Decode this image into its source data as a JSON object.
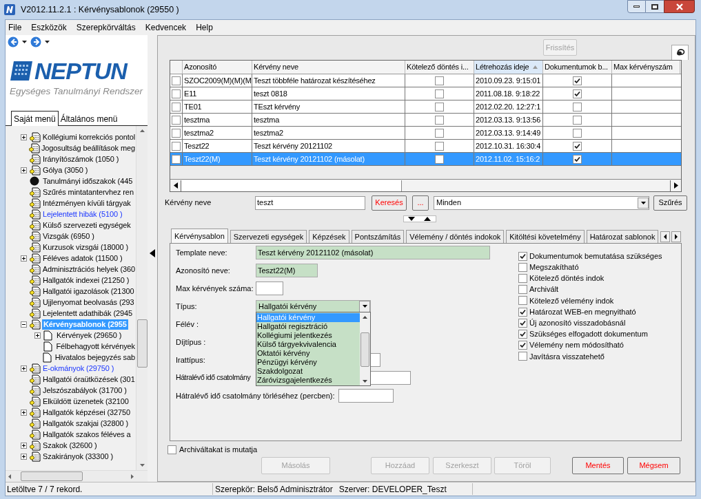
{
  "window": {
    "title": "V2012.11.2.1 : Kérvénysablonok (29550 )"
  },
  "menu": [
    "File",
    "Eszközök",
    "Szerepkörváltás",
    "Kedvencek",
    "Help"
  ],
  "logo": {
    "name": "NEPTUN",
    "tagline": "Egységes Tanulmányi Rendszer"
  },
  "sidebar": {
    "tabs": [
      {
        "label": "Saját menü",
        "selected": true
      },
      {
        "label": "Általános menü",
        "selected": false
      }
    ],
    "tree": [
      {
        "label": "Kollégiumi korrekciós pontol",
        "expanded": false,
        "kind": "form",
        "link": false,
        "selected": false
      },
      {
        "label": "Jogosultság beállítások meg",
        "kind": "form",
        "link": false,
        "selected": false
      },
      {
        "label": "Irányítószámok (1050  )",
        "kind": "form",
        "link": false,
        "selected": false
      },
      {
        "label": "Gólya (3050  )",
        "expanded": false,
        "kind": "form",
        "link": false,
        "selected": false
      },
      {
        "label": "Tanulmányi időszakok (445",
        "kind": "ball",
        "link": false,
        "selected": false
      },
      {
        "label": "Szűrés mintatantervhez ren",
        "kind": "form",
        "link": false,
        "selected": false
      },
      {
        "label": "Intézményen kívüli tárgyak",
        "kind": "form",
        "link": false,
        "selected": false
      },
      {
        "label": "Lejelentett hibák (5100  )",
        "kind": "form",
        "link": true,
        "selected": false
      },
      {
        "label": "Külső szervezeti egységek",
        "kind": "form",
        "link": false,
        "selected": false
      },
      {
        "label": "Vizsgák (6950  )",
        "kind": "form",
        "link": false,
        "selected": false
      },
      {
        "label": "Kurzusok vizsgái (18000  )",
        "kind": "form",
        "link": false,
        "selected": false
      },
      {
        "label": "Féléves adatok (11500  )",
        "expanded": false,
        "kind": "form",
        "link": false,
        "selected": false
      },
      {
        "label": "Adminisztrációs helyek (360",
        "kind": "form",
        "link": false,
        "selected": false
      },
      {
        "label": "Hallgatók indexei (21250  )",
        "kind": "form",
        "link": false,
        "selected": false
      },
      {
        "label": "Hallgatói igazolások (21300",
        "kind": "form",
        "link": false,
        "selected": false
      },
      {
        "label": "Ujjlenyomat beolvasás (293",
        "kind": "form",
        "link": false,
        "selected": false
      },
      {
        "label": "Lejelentett adathibák (2945",
        "kind": "form",
        "link": false,
        "selected": false
      },
      {
        "label": "Kérvénysablonok (2955",
        "expanded": true,
        "kind": "form",
        "link": false,
        "selected": true,
        "children": [
          {
            "label": "Kérvények (29650  )",
            "expanded": false,
            "kind": "page",
            "link": false,
            "selected": false
          },
          {
            "label": "Félbehagyott kérvények",
            "kind": "page",
            "link": false,
            "selected": false
          },
          {
            "label": "Hivatalos bejegyzés sab",
            "kind": "page",
            "link": false,
            "selected": false
          }
        ]
      },
      {
        "label": "E-okmányok (29750  )",
        "expanded": false,
        "kind": "form",
        "link": true,
        "selected": false
      },
      {
        "label": "Hallgatói óraütközések (301",
        "kind": "form",
        "link": false,
        "selected": false
      },
      {
        "label": "Jelszószabályok (31700  )",
        "kind": "form",
        "link": false,
        "selected": false
      },
      {
        "label": "Elküldött üzenetek (32100",
        "kind": "form",
        "link": false,
        "selected": false
      },
      {
        "label": "Hallgatók képzései (32750",
        "expanded": false,
        "kind": "form",
        "link": false,
        "selected": false
      },
      {
        "label": "Hallgatók szakjai (32800  )",
        "kind": "form",
        "link": false,
        "selected": false
      },
      {
        "label": "Hallgatók szakos féléves a",
        "kind": "form",
        "link": false,
        "selected": false
      },
      {
        "label": "Szakok (32600  )",
        "expanded": false,
        "kind": "form",
        "link": false,
        "selected": false
      },
      {
        "label": "Szakirányok (33300  )",
        "expanded": false,
        "kind": "form",
        "link": false,
        "selected": false
      }
    ]
  },
  "refresh_button": {
    "label": "Frissítés",
    "disabled": true
  },
  "table": {
    "columns": [
      {
        "label": "Azonosító",
        "sorted": false
      },
      {
        "label": "Kérvény neve",
        "sorted": false
      },
      {
        "label": "Kötelező döntés i...",
        "sorted": false
      },
      {
        "label": "Létrehozás ideje",
        "sorted": true
      },
      {
        "label": "Dokumentumok b...",
        "sorted": false
      },
      {
        "label": "Max kérvényszám",
        "sorted": false
      }
    ],
    "rows": [
      {
        "checked": false,
        "id": "SZOC2009(M)(M)(M",
        "name": "Teszt többféle határozat készítéséhez",
        "mandatory_decision": false,
        "created": "2010.09.23. 9:15:01",
        "documents": true,
        "selected": false
      },
      {
        "checked": false,
        "id": "E11",
        "name": "teszt 0818",
        "mandatory_decision": false,
        "created": "2011.08.18. 9:18:22",
        "documents": true,
        "selected": false
      },
      {
        "checked": false,
        "id": "TE01",
        "name": "TEszt kérvény",
        "mandatory_decision": false,
        "created": "2012.02.20. 12:27:1",
        "documents": false,
        "selected": false
      },
      {
        "checked": false,
        "id": "tesztma",
        "name": "tesztma",
        "mandatory_decision": false,
        "created": "2012.03.13. 9:13:56",
        "documents": false,
        "selected": false
      },
      {
        "checked": false,
        "id": "tesztma2",
        "name": "tesztma2",
        "mandatory_decision": false,
        "created": "2012.03.13. 9:14:49",
        "documents": false,
        "selected": false
      },
      {
        "checked": false,
        "id": "Teszt22",
        "name": "Teszt kérvény 20121102",
        "mandatory_decision": false,
        "created": "2012.10.31. 16:30:4",
        "documents": true,
        "selected": false
      },
      {
        "checked": false,
        "id": "Teszt22(M)",
        "name": "Teszt kérvény 20121102 (másolat)",
        "mandatory_decision": false,
        "created": "2012.11.02. 15:16:2",
        "documents": true,
        "selected": true
      }
    ]
  },
  "search": {
    "label": "Kérvény neve",
    "value": "teszt",
    "search_button": "Keresés",
    "more_button": "...",
    "filter": "Minden",
    "filter_button": "Szűrés"
  },
  "detail_tabs": [
    {
      "label": "Kérvénysablon",
      "selected": true
    },
    {
      "label": "Szervezeti egységek",
      "selected": false
    },
    {
      "label": "Képzések",
      "selected": false
    },
    {
      "label": "Pontszámítás",
      "selected": false
    },
    {
      "label": "Vélemény / döntés indokok",
      "selected": false
    },
    {
      "label": "Kitöltési követelmény",
      "selected": false
    },
    {
      "label": "Határozat sablonok",
      "selected": false
    }
  ],
  "form": [
    {
      "kind": "text",
      "label": "Template neve:",
      "value": "Teszt kérvény 20121102 (másolat)",
      "required": true
    },
    {
      "kind": "text",
      "label": "Azonosító neve:",
      "value": "Teszt22(M)",
      "required": true
    },
    {
      "kind": "text",
      "label": "Max kérvények száma:",
      "required": false
    },
    {
      "kind": "select",
      "label": "Típus:",
      "value": "Hallgatói kérvény",
      "required": true,
      "open": true,
      "options": [
        {
          "label": "Hallgatói kérvény",
          "selected": true
        },
        {
          "label": "Hallgatói regisztráció",
          "selected": false
        },
        {
          "label": "Kollégiumi jelentkezés",
          "selected": false
        },
        {
          "label": "Külső tárgyekvivalencia",
          "selected": false
        },
        {
          "label": "Oktatói kérvény",
          "selected": false
        },
        {
          "label": "Pénzügyi kérvény",
          "selected": false
        },
        {
          "label": "Szakdolgozat",
          "selected": false
        },
        {
          "label": "Záróvizsgajelentkezés",
          "selected": false
        }
      ]
    },
    {
      "kind": "label",
      "label": "Félév :"
    },
    {
      "kind": "label",
      "label": "Díjtípus :"
    },
    {
      "kind": "text",
      "label": "Irattípus:",
      "required": false
    },
    {
      "kind": "text",
      "label": "Hátralévő idő csatolmány",
      "required": false
    },
    {
      "kind": "text",
      "label": "Hátralévő idő csatolmány törléséhez (percben):",
      "required": false
    }
  ],
  "options": [
    {
      "label": "Dokumentumok bemutatása szükséges",
      "checked": true
    },
    {
      "label": "Megszakítható",
      "checked": false
    },
    {
      "label": "Kötelező döntés indok",
      "checked": false
    },
    {
      "label": "Archivált",
      "checked": false
    },
    {
      "label": "Kötelező vélemény indok",
      "checked": false
    },
    {
      "label": "Határozat WEB-en megnyitható",
      "checked": true
    },
    {
      "label": "Új azonosító visszadobásnál",
      "checked": true
    },
    {
      "label": "Szükséges elfogadott dokumentum",
      "checked": true
    },
    {
      "label": "Vélemény nem módosítható",
      "checked": true
    },
    {
      "label": "Javításra visszatehető",
      "checked": false
    }
  ],
  "archive_checkbox": {
    "label": "Archiváltakat is mutatja",
    "checked": false
  },
  "buttons": [
    {
      "label": "Másolás",
      "disabled": true,
      "highlighted": false
    },
    {
      "label": "Hozzáad",
      "disabled": true,
      "highlighted": false
    },
    {
      "label": "Szerkeszt",
      "disabled": true,
      "highlighted": false
    },
    {
      "label": "Töröl",
      "disabled": true,
      "highlighted": false
    },
    {
      "label": "Mentés",
      "disabled": false,
      "highlighted": true
    },
    {
      "label": "Mégsem",
      "disabled": false,
      "highlighted": true
    }
  ],
  "status_bar": {
    "records": "Letöltve 7 / 7 rekord.",
    "role": "Szerepkör: Belső Adminisztrátor",
    "server": "Szerver: DEVELOPER_Teszt"
  }
}
